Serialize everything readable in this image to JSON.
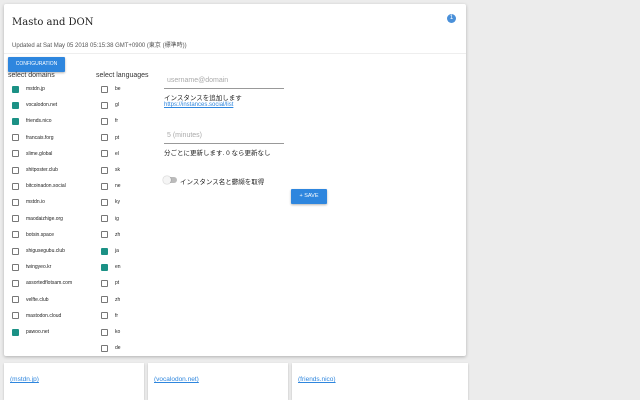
{
  "header": {
    "title": "Masto and DON",
    "badge": "1",
    "updated": "Updated at Sat May 05 2018 05:15:38 GMT+0900 (東京 (標準時))"
  },
  "config_button": "CONFIGURATION",
  "domains": {
    "heading": "select domains",
    "items": [
      {
        "label": "mstdn.jp",
        "checked": true
      },
      {
        "label": "vocalodon.net",
        "checked": true
      },
      {
        "label": "friends.nico",
        "checked": true
      },
      {
        "label": "francais.forg",
        "checked": false
      },
      {
        "label": "slime.global",
        "checked": false
      },
      {
        "label": "shitposter.club",
        "checked": false
      },
      {
        "label": "bitcoinadon.social",
        "checked": false
      },
      {
        "label": "mstdn.io",
        "checked": false
      },
      {
        "label": "maodaizhige.org",
        "checked": false
      },
      {
        "label": "botsin.space",
        "checked": false
      },
      {
        "label": "shigusegubu.club",
        "checked": false
      },
      {
        "label": "twingyeo.kr",
        "checked": false
      },
      {
        "label": "assortedflotsam.com",
        "checked": false
      },
      {
        "label": "velfte.club",
        "checked": false
      },
      {
        "label": "mastodon.cloud",
        "checked": false
      },
      {
        "label": "pawoo.net",
        "checked": true
      }
    ]
  },
  "languages": {
    "heading": "select languages",
    "items": [
      {
        "label": "be",
        "checked": false
      },
      {
        "label": "gl",
        "checked": false
      },
      {
        "label": "fr",
        "checked": false
      },
      {
        "label": "pt",
        "checked": false
      },
      {
        "label": "el",
        "checked": false
      },
      {
        "label": "sk",
        "checked": false
      },
      {
        "label": "ne",
        "checked": false
      },
      {
        "label": "ky",
        "checked": false
      },
      {
        "label": "ig",
        "checked": false
      },
      {
        "label": "zh",
        "checked": false
      },
      {
        "label": "ja",
        "checked": true
      },
      {
        "label": "en",
        "checked": true
      },
      {
        "label": "pt",
        "checked": false
      },
      {
        "label": "zh",
        "checked": false
      },
      {
        "label": "fr",
        "checked": false
      },
      {
        "label": "ko",
        "checked": false
      },
      {
        "label": "de",
        "checked": false
      }
    ]
  },
  "instance_field": {
    "placeholder": "username@domain",
    "help": "インスタンスを追加します",
    "link": "https://instances.social/list"
  },
  "interval_field": {
    "placeholder": "5 (minutes)",
    "help": "分ごとに更新します. 0 なら更新なし"
  },
  "toggle": {
    "label": "インスタンス名と鬱纐を取得",
    "on": false
  },
  "save_button": "+ SAVE",
  "timelines": [
    "(mstdn.jp)",
    "(vocalodon.net)",
    "(friends.nico)"
  ],
  "colors": {
    "accent": "#2e86de",
    "checked": "#1b9185"
  }
}
